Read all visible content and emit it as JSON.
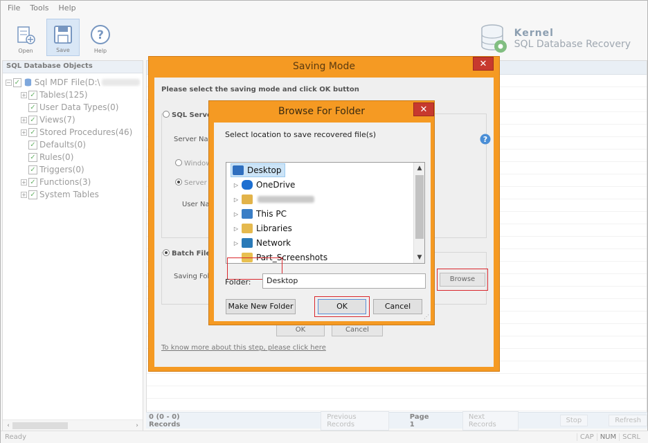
{
  "menu": [
    "File",
    "Tools",
    "Help"
  ],
  "toolbar": {
    "open": "Open",
    "save": "Save",
    "help": "Help"
  },
  "brand": {
    "name": "Kernel",
    "product": "SQL Database Recovery"
  },
  "left_panel": {
    "title": "SQL Database Objects",
    "root": "Sql MDF File(D:\\",
    "items": [
      "Tables(125)",
      "User Data Types(0)",
      "Views(7)",
      "Stored Procedures(46)",
      "Defaults(0)",
      "Rules(0)",
      "Triggers(0)",
      "Functions(3)",
      "System Tables"
    ]
  },
  "pager": {
    "records": "0 (0 - 0) Records",
    "prev": "Previous Records",
    "page": "Page 1",
    "next": "Next Records",
    "stop": "Stop",
    "refresh": "Refresh"
  },
  "status": {
    "ready": "Ready",
    "cap": "CAP",
    "num": "NUM",
    "scrl": "SCRL"
  },
  "saving": {
    "title": "Saving Mode",
    "instruction": "Please select the saving mode and click OK button",
    "sql_server": "SQL Server",
    "server_name": "Server Na",
    "windows": "Window",
    "server": "Server",
    "user_name": "User Na",
    "batch_file": "Batch File",
    "saving_folder": "Saving Fol",
    "browse": "Browse",
    "ok": "OK",
    "cancel": "Cancel",
    "link": "To know more about this step, please click here"
  },
  "browse_dialog": {
    "title": "Browse For Folder",
    "label": "Select location to save recovered file(s)",
    "items": [
      "Desktop",
      "OneDrive",
      "",
      "This PC",
      "Libraries",
      "Network",
      "Part_Screenshots"
    ],
    "folder_label": "Folder:",
    "folder_value": "Desktop",
    "make_new": "Make New Folder",
    "ok": "OK",
    "cancel": "Cancel"
  },
  "colors": {
    "dialog_frame": "#f59a23",
    "close": "#c7392e",
    "highlight": "#d9262c",
    "selection": "#cce4f7"
  }
}
